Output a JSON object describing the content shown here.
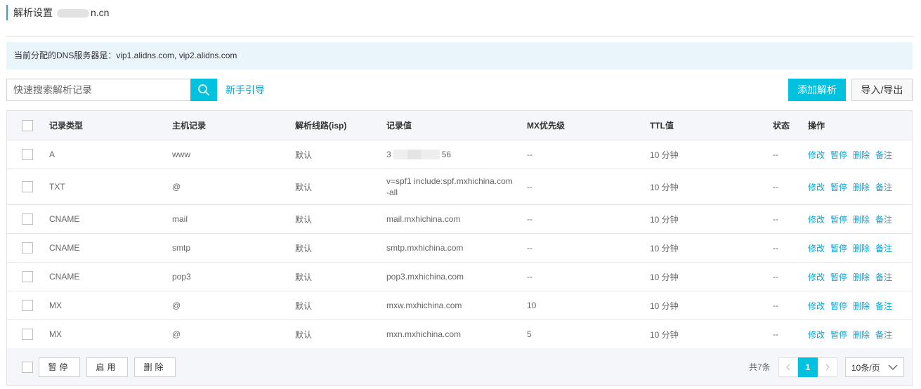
{
  "header": {
    "title": "解析设置",
    "domain_suffix": "n.cn"
  },
  "notice": {
    "text": "当前分配的DNS服务器是：vip1.alidns.com, vip2.alidns.com"
  },
  "toolbar": {
    "search_placeholder": "快速搜索解析记录",
    "guide_label": "新手引导",
    "add_label": "添加解析",
    "import_export_label": "导入/导出"
  },
  "table": {
    "columns": [
      "记录类型",
      "主机记录",
      "解析线路(isp)",
      "记录值",
      "MX优先级",
      "TTL值",
      "状态",
      "操作"
    ],
    "rows": [
      {
        "type": "A",
        "host": "www",
        "line": "默认",
        "value_prefix": "3",
        "value_suffix": "56",
        "mx": "--",
        "ttl": "10 分钟",
        "status": "--"
      },
      {
        "type": "TXT",
        "host": "@",
        "line": "默认",
        "value": "v=spf1 include:spf.mxhichina.com -all",
        "mx": "--",
        "ttl": "10 分钟",
        "status": "--"
      },
      {
        "type": "CNAME",
        "host": "mail",
        "line": "默认",
        "value": "mail.mxhichina.com",
        "mx": "--",
        "ttl": "10 分钟",
        "status": "--"
      },
      {
        "type": "CNAME",
        "host": "smtp",
        "line": "默认",
        "value": "smtp.mxhichina.com",
        "mx": "--",
        "ttl": "10 分钟",
        "status": "--"
      },
      {
        "type": "CNAME",
        "host": "pop3",
        "line": "默认",
        "value": "pop3.mxhichina.com",
        "mx": "--",
        "ttl": "10 分钟",
        "status": "--"
      },
      {
        "type": "MX",
        "host": "@",
        "line": "默认",
        "value": "mxw.mxhichina.com",
        "mx": "10",
        "ttl": "10 分钟",
        "status": "--"
      },
      {
        "type": "MX",
        "host": "@",
        "line": "默认",
        "value": "mxn.mxhichina.com",
        "mx": "5",
        "ttl": "10 分钟",
        "status": "--"
      }
    ],
    "actions": [
      "修改",
      "暂停",
      "删除",
      "备注"
    ]
  },
  "footer": {
    "pause_label": "暂停",
    "enable_label": "启用",
    "delete_label": "删除",
    "total_label": "共7条",
    "current_page": "1",
    "per_page_label": "10条/页"
  },
  "colors": {
    "accent": "#00c1de",
    "link": "#00a3d4",
    "notice_bg": "#eaf4fb",
    "header_bg": "#f5f6fa"
  }
}
